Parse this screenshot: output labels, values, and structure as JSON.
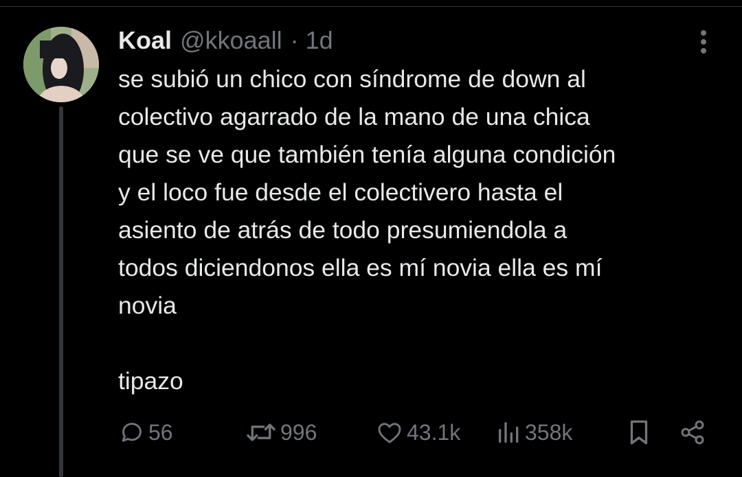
{
  "tweet": {
    "display_name": "Koal",
    "handle": "@kkoaall",
    "separator": "·",
    "time": "1d",
    "text": "se subió un chico con síndrome de down al\ncolectivo agarrado de la mano de una chica\nque se ve que también tenía alguna condición\ny el loco fue desde el colectivero hasta el\nasiento de atrás de todo presumiendola a\ntodos diciendonos ella es mí novia ella es mí\nnovia\n\ntipazo"
  },
  "actions": {
    "replies": "56",
    "reposts": "996",
    "likes": "43.1k",
    "views": "358k"
  },
  "icons": {
    "more": "more-horizontal-icon",
    "reply": "reply-bubble-icon",
    "repost": "repost-arrows-icon",
    "like": "heart-icon",
    "views": "bar-chart-icon",
    "bookmark": "bookmark-icon",
    "share": "share-icon"
  },
  "colors": {
    "background": "#000000",
    "text": "#e7e9ea",
    "muted": "#71767b",
    "divider": "#2f3336"
  }
}
